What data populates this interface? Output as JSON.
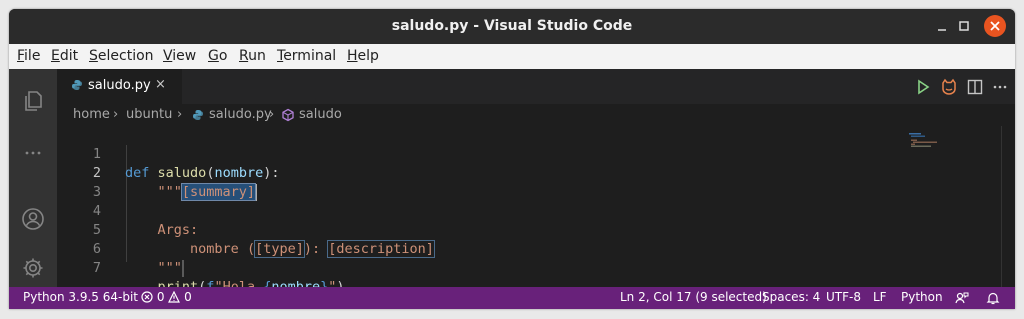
{
  "window": {
    "title": "saludo.py - Visual Studio Code"
  },
  "menu": [
    {
      "label": "File",
      "u": "F",
      "rest": "ile"
    },
    {
      "label": "Edit",
      "u": "E",
      "rest": "dit"
    },
    {
      "label": "Selection",
      "u": "S",
      "rest": "election"
    },
    {
      "label": "View",
      "u": "V",
      "rest": "iew"
    },
    {
      "label": "Go",
      "u": "G",
      "rest": "o"
    },
    {
      "label": "Run",
      "u": "R",
      "rest": "un"
    },
    {
      "label": "Terminal",
      "u": "T",
      "rest": "erminal"
    },
    {
      "label": "Help",
      "u": "H",
      "rest": "elp"
    }
  ],
  "tab": {
    "label": "saludo.py",
    "close": "×"
  },
  "breadcrumb": {
    "items": [
      "home",
      "ubuntu",
      "saludo.py",
      "saludo"
    ],
    "sep": "›"
  },
  "code": {
    "line_numbers": [
      "1",
      "2",
      "3",
      "4",
      "5",
      "6",
      "7"
    ],
    "l1": {
      "kw": "def",
      "fn": "saludo",
      "p1": "(",
      "param": "nombre",
      "p2": "):"
    },
    "l2": {
      "quotes": "\"\"\"",
      "sel": "[summary]"
    },
    "l4": {
      "text": "Args:"
    },
    "l5": {
      "name": "nombre",
      "open": " (",
      "type": "[type]",
      "close": "): ",
      "desc": "[description]"
    },
    "l6": {
      "quotes": "\"\"\""
    },
    "l7": {
      "fn": "print",
      "p1": "(",
      "f": "f",
      "s1": "\"Hola ",
      "b1": "{",
      "var": "nombre",
      "b2": "}",
      "s2": "\"",
      "p2": ")"
    }
  },
  "status": {
    "python": "Python 3.9.5 64-bit",
    "errors": "0",
    "warnings": "0",
    "position": "Ln 2, Col 17 (9 selected)",
    "spaces": "Spaces: 4",
    "encoding": "UTF-8",
    "eol": "LF",
    "language": "Python"
  },
  "colors": {
    "status_bar": "#68217a",
    "editor_bg": "#1e1e1e",
    "close_button": "#e95420"
  }
}
